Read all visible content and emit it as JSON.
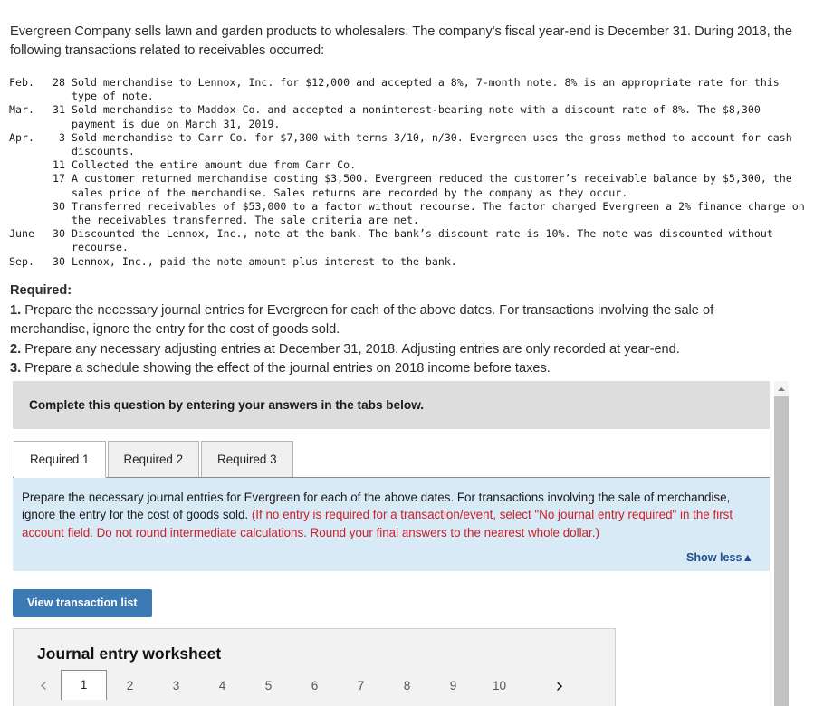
{
  "intro": "Evergreen Company sells lawn and garden products to wholesalers. The company's fiscal year-end is December 31. During 2018, the following transactions related to receivables occurred:",
  "transactions": [
    {
      "month": "Feb.",
      "day": "28",
      "text": "Sold merchandise to Lennox, Inc. for $12,000 and accepted a 8%, 7-month note. 8% is an appropriate rate for this type of note."
    },
    {
      "month": "Mar.",
      "day": "31",
      "text": "Sold merchandise to Maddox Co. and accepted a noninterest-bearing note with a discount rate of 8%. The $8,300 payment is due on March 31, 2019."
    },
    {
      "month": "Apr.",
      "day": "3",
      "text": "Sold merchandise to Carr Co. for $7,300 with terms 3/10, n/30. Evergreen uses the gross method to account for cash discounts."
    },
    {
      "month": "",
      "day": "11",
      "text": "Collected the entire amount due from Carr Co."
    },
    {
      "month": "",
      "day": "17",
      "text": "A customer returned merchandise costing $3,500. Evergreen reduced the customer’s receivable balance by $5,300, the sales price of the merchandise. Sales returns are recorded by the company as they occur."
    },
    {
      "month": "",
      "day": "30",
      "text": "Transferred receivables of $53,000 to a factor without recourse. The factor charged Evergreen a 2% finance charge on the receivables transferred. The sale criteria are met."
    },
    {
      "month": "June",
      "day": "30",
      "text": "Discounted the Lennox, Inc., note at the bank. The bank’s discount rate is 10%. The note was discounted without recourse."
    },
    {
      "month": "Sep.",
      "day": "30",
      "text": "Lennox, Inc., paid the note amount plus interest to the bank."
    }
  ],
  "required": {
    "heading": "Required:",
    "items": [
      {
        "num": "1.",
        "text": " Prepare the necessary journal entries for Evergreen for each of the above dates. For transactions involving the sale of merchandise, ignore the entry for the cost of goods sold."
      },
      {
        "num": "2.",
        "text": " Prepare any necessary adjusting entries at December 31, 2018. Adjusting entries are only recorded at year-end."
      },
      {
        "num": "3.",
        "text": " Prepare a schedule showing the effect of the journal entries on 2018 income before taxes."
      }
    ]
  },
  "widget": {
    "header": "Complete this question by entering your answers in the tabs below.",
    "tabs": [
      {
        "label": "Required 1",
        "active": true
      },
      {
        "label": "Required 2",
        "active": false
      },
      {
        "label": "Required 3",
        "active": false
      }
    ],
    "infobox": {
      "black_text": "Prepare the necessary journal entries for Evergreen for each of the above dates. For transactions involving the sale of merchandise, ignore the entry for the cost of goods sold. ",
      "red_text": "(If no entry is required for a transaction/event, select \"No journal entry required\" in the first account field. Do not round intermediate calculations. Round your final answers to the nearest whole dollar.)",
      "show_less": "Show less▲"
    },
    "view_transaction_list": "View transaction list",
    "worksheet": {
      "title": "Journal entry worksheet",
      "prev_icon": "‹",
      "next_icon": "›",
      "pages": [
        "1",
        "2",
        "3",
        "4",
        "5",
        "6",
        "7",
        "8",
        "9",
        "10"
      ],
      "active_page": "1"
    }
  },
  "colors": {
    "accent_blue": "#3b7ab5",
    "info_bg": "#d9eaf7",
    "warn_red": "#cc2026",
    "link_navy": "#1d4f91",
    "header_gray": "#dddddd"
  }
}
